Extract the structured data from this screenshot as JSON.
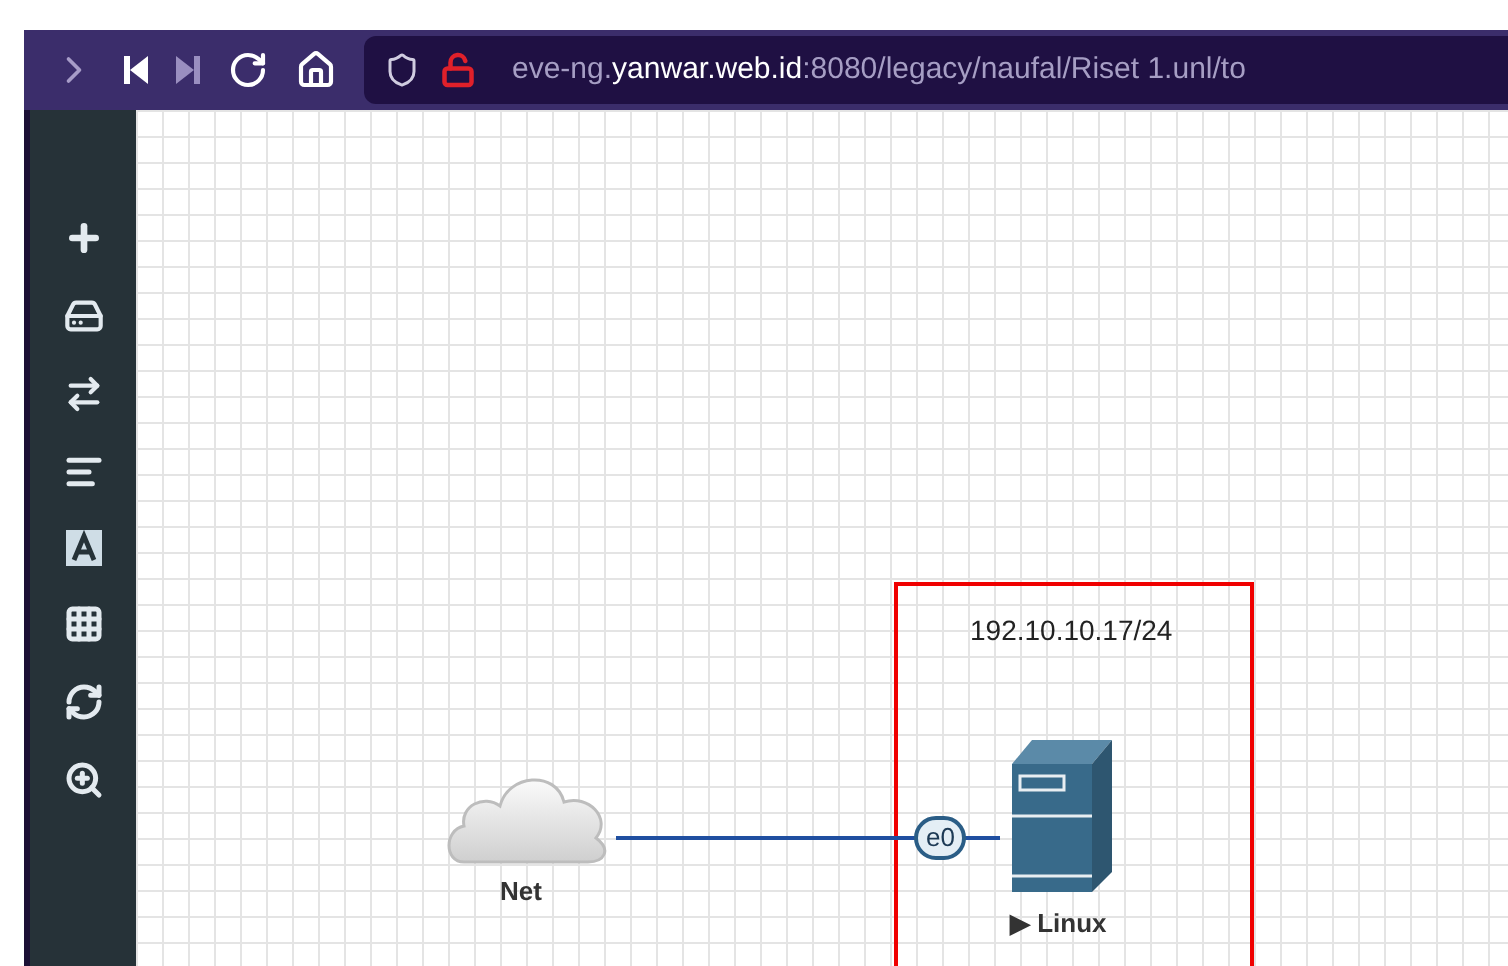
{
  "address_bar": {
    "prefix": "eve-ng.",
    "host": "yanwar.web.id",
    "rest": ":8080/legacy/naufal/Riset 1.unl/to"
  },
  "canvas": {
    "text_label": "192.10.10.17/24",
    "nodes": [
      {
        "kind": "cloud",
        "label": "Net"
      },
      {
        "kind": "server",
        "label": "▶ Linux"
      }
    ],
    "link": {
      "interface": "e0"
    }
  }
}
